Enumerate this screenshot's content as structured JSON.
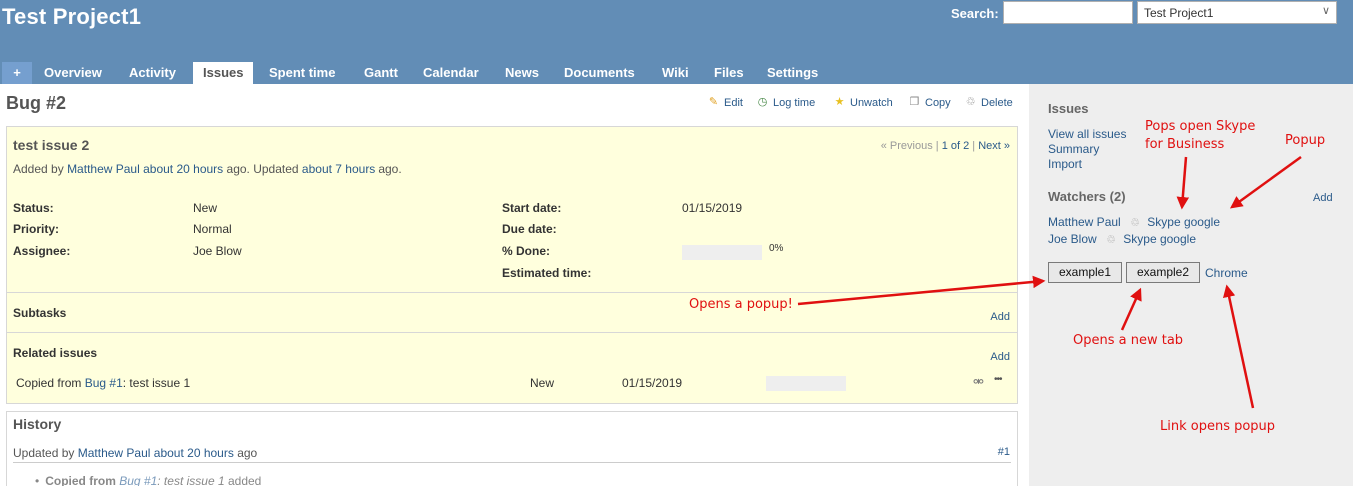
{
  "header": {
    "project_title": "Test Project1",
    "search_label": "Search:",
    "search_value": "",
    "project_select": "Test Project1"
  },
  "menu": {
    "plus": "+",
    "items": [
      "Overview",
      "Activity",
      "Issues",
      "Spent time",
      "Gantt",
      "Calendar",
      "News",
      "Documents",
      "Wiki",
      "Files",
      "Settings"
    ],
    "selected": "Issues"
  },
  "issue": {
    "heading": "Bug #2",
    "actions": {
      "edit": "Edit",
      "log_time": "Log time",
      "unwatch": "Unwatch",
      "copy": "Copy",
      "delete": "Delete"
    },
    "subject": "test issue 2",
    "author_prefix": "Added by",
    "author": "Matthew Paul",
    "added_ago": "about 20 hours",
    "updated_prefix": "ago. Updated",
    "updated_ago": "about 7 hours",
    "updated_suffix": "ago.",
    "pager": {
      "previous": "« Previous",
      "position": "1 of 2",
      "next": "Next »"
    },
    "attributes": {
      "status_label": "Status:",
      "status": "New",
      "priority_label": "Priority:",
      "priority": "Normal",
      "assignee_label": "Assignee:",
      "assignee": "Joe Blow",
      "start_date_label": "Start date:",
      "start_date": "01/15/2019",
      "due_date_label": "Due date:",
      "due_date": "",
      "done_label": "% Done:",
      "done_percent": "0%",
      "done_value": 0,
      "estimated_label": "Estimated time:",
      "estimated": ""
    },
    "subtasks": {
      "title": "Subtasks",
      "add": "Add"
    },
    "related": {
      "title": "Related issues",
      "add": "Add",
      "row": {
        "prefix": "Copied from",
        "issue_link": "Bug #1",
        "subject": ": test issue 1",
        "status": "New",
        "date": "01/15/2019",
        "done_value": 0,
        "icon": "unlink-icon",
        "more": "•••"
      }
    }
  },
  "history": {
    "title": "History",
    "updated_prefix": "Updated by",
    "author": "Matthew Paul",
    "ago": "about 20 hours",
    "ago_suffix": "ago",
    "journal_num": "#1",
    "detail_label": "Copied from",
    "detail_link": "Bug #1",
    "detail_subject": ": test issue 1",
    "detail_suffix": "added"
  },
  "sidebar": {
    "issues_title": "Issues",
    "links": [
      "View all issues",
      "Summary",
      "Import"
    ],
    "watchers_title": "Watchers (2)",
    "watchers_add": "Add",
    "watchers": [
      {
        "name": "Matthew Paul",
        "extra": "Skype google"
      },
      {
        "name": "Joe Blow",
        "extra": "Skype google"
      }
    ],
    "buttons": [
      "example1",
      "example2"
    ],
    "chrome_link": "Chrome"
  },
  "annotations": {
    "skype": "Pops open Skype\nfor Business",
    "popup": "Popup",
    "opens_popup": "Opens a popup!",
    "new_tab": "Opens a new tab",
    "link_popup": "Link opens popup",
    "color": "#e01010"
  }
}
